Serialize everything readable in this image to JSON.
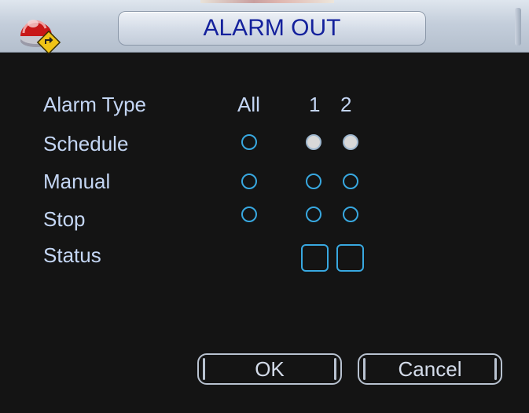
{
  "window": {
    "title": "ALARM OUT"
  },
  "header": {
    "alarm_type_label": "Alarm Type",
    "columns": [
      "All",
      "1",
      "2"
    ]
  },
  "rows": [
    {
      "label": "Schedule",
      "all_selected": false,
      "ch1_selected": true,
      "ch2_selected": true
    },
    {
      "label": "Manual",
      "all_selected": false,
      "ch1_selected": false,
      "ch2_selected": false
    },
    {
      "label": "Stop",
      "all_selected": false,
      "ch1_selected": false,
      "ch2_selected": false
    }
  ],
  "status": {
    "label": "Status",
    "ch1": "",
    "ch2": ""
  },
  "buttons": {
    "ok": "OK",
    "cancel": "Cancel"
  },
  "icons": {
    "logo": "alarm-output-icon"
  },
  "colors": {
    "title_text": "#14219c",
    "label_text": "#c4d6f4",
    "radio_border": "#38a8e0",
    "radio_selected": "#d8d8d8",
    "background": "#141414"
  }
}
